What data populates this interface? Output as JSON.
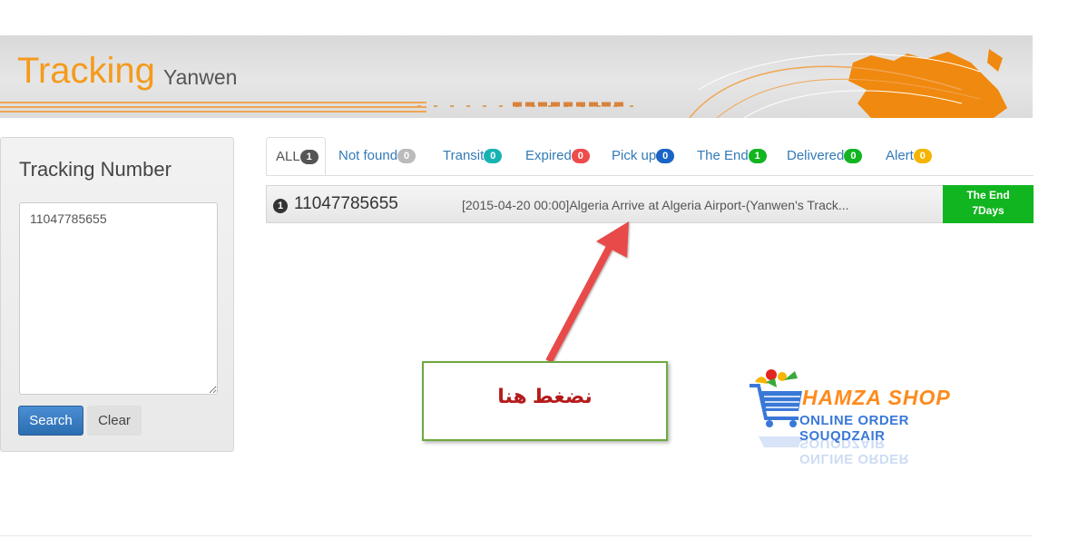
{
  "banner": {
    "title": "Tracking",
    "subtitle": "Yanwen",
    "accent": "#f59a1c"
  },
  "sidebar": {
    "heading": "Tracking Number",
    "textarea_value": "11047785655",
    "search_label": "Search",
    "clear_label": "Clear"
  },
  "tabs": [
    {
      "label": "ALL",
      "count": "1",
      "color": "#555555"
    },
    {
      "label": "Not found",
      "count": "0",
      "color": "#bbbbbb"
    },
    {
      "label": "Transit",
      "count": "0",
      "color": "#17b3b3"
    },
    {
      "label": "Expired",
      "count": "0",
      "color": "#ee4b4b"
    },
    {
      "label": "Pick up",
      "count": "0",
      "color": "#1a64c6"
    },
    {
      "label": "The End",
      "count": "1",
      "color": "#11b520"
    },
    {
      "label": "Delivered",
      "count": "0",
      "color": "#11b520"
    },
    {
      "label": "Alert",
      "count": "0",
      "color": "#f4b400"
    }
  ],
  "result": {
    "index": "1",
    "tracking_number": "11047785655",
    "last_event": "[2015-04-20 00:00]Algeria Arrive at Algeria Airport-(Yanwen's Track...",
    "status": "The End",
    "days": "7Days",
    "status_color": "#11b520"
  },
  "annotation": {
    "text": "نضغط هنا"
  },
  "logo": {
    "name": "HAMZA SHOP",
    "tagline": "ONLINE ORDER SOUQDZAIR"
  }
}
